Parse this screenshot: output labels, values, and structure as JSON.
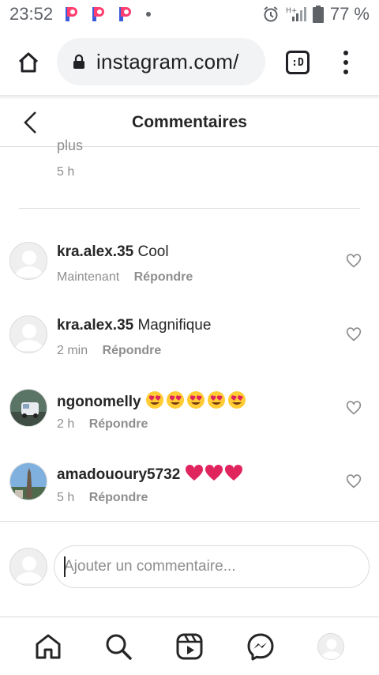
{
  "status_bar": {
    "time": "23:52",
    "battery": "77 %",
    "network": "H+",
    "icons": [
      "p-app-icon",
      "p-app-icon",
      "p-app-icon",
      "notification-dot",
      "alarm-icon",
      "signal-icon",
      "battery-icon"
    ]
  },
  "browser": {
    "url": "instagram.com/",
    "tabs_label": ":D",
    "icons": [
      "home-icon",
      "lock-icon",
      "tabs-icon",
      "menu-icon"
    ]
  },
  "header": {
    "title": "Commentaires",
    "back_icon": "chevron-left-icon"
  },
  "caption": {
    "tail_text": "plus",
    "time": "5 h"
  },
  "comments": [
    {
      "username": "kra.alex.35",
      "text": "Cool",
      "time": "Maintenant",
      "reply_label": "Répondre",
      "avatar": "default"
    },
    {
      "username": "kra.alex.35",
      "text": "Magnifique",
      "time": "2 min",
      "reply_label": "Répondre",
      "avatar": "default"
    },
    {
      "username": "ngonomelly",
      "text": "😍😍😍😍😍",
      "time": "2 h",
      "reply_label": "Répondre",
      "avatar": "photo"
    },
    {
      "username": "amadououry5732",
      "text": "❤❤❤",
      "time": "5 h",
      "reply_label": "Répondre",
      "avatar": "photo"
    }
  ],
  "add_comment": {
    "placeholder": "Ajouter un commentaire..."
  },
  "bottom_nav": {
    "items": [
      "home-icon",
      "search-icon",
      "reels-icon",
      "messenger-icon",
      "profile-avatar"
    ]
  },
  "colors": {
    "text_primary": "#262626",
    "text_secondary": "#8e8e8e",
    "border": "#dbdbdb",
    "heart_red": "#e0245e",
    "p_app_pink": "#ff3d6e",
    "p_app_blue": "#3b5bdb"
  }
}
